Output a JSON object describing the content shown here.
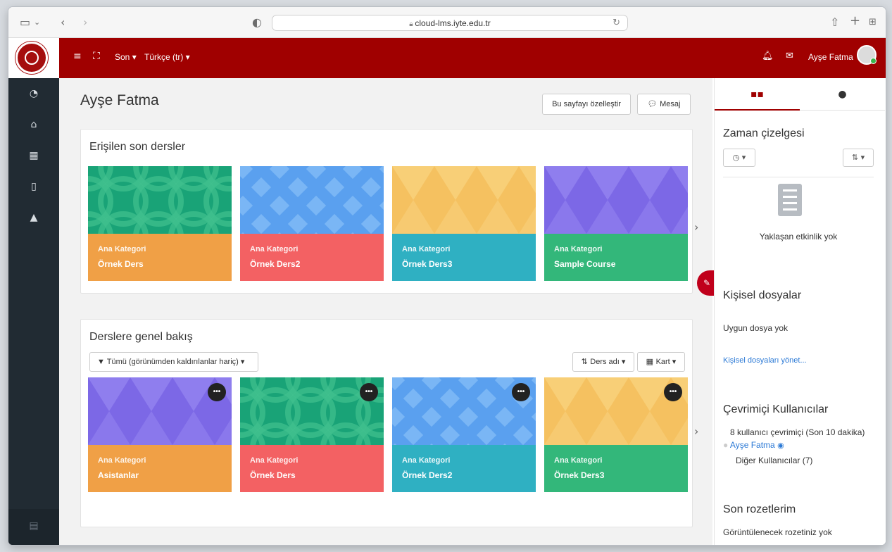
{
  "browser": {
    "url": "cloud-lms.iyte.edu.tr"
  },
  "navbar": {
    "recent_menu": "Son",
    "language_menu": "Türkçe (tr)",
    "user_name": "Ayşe Fatma"
  },
  "page": {
    "title": "Ayşe Fatma",
    "customize_button": "Bu sayfayı özelleştir",
    "message_button": "Mesaj"
  },
  "recent_courses": {
    "title": "Erişilen son dersler",
    "items": [
      {
        "category": "Ana Kategori",
        "name": "Örnek Ders",
        "color": "#f0a046",
        "pattern": "circles-green"
      },
      {
        "category": "Ana Kategori",
        "name": "Örnek Ders2",
        "color": "#f36163",
        "pattern": "diamonds-blue"
      },
      {
        "category": "Ana Kategori",
        "name": "Örnek Ders3",
        "color": "#2fb0c2",
        "pattern": "triangles-yellow"
      },
      {
        "category": "Ana Kategori",
        "name": "Sample Course",
        "color": "#33b77a",
        "pattern": "triangles-purple"
      }
    ]
  },
  "course_overview": {
    "title": "Derslere genel bakış",
    "filter_label": "Tümü (görünümden kaldırılanlar hariç)",
    "sort_label": "Ders adı",
    "view_label": "Kart",
    "items": [
      {
        "category": "Ana Kategori",
        "name": "Asistanlar",
        "color": "#f0a046",
        "pattern": "triangles-purple"
      },
      {
        "category": "Ana Kategori",
        "name": "Örnek Ders",
        "color": "#f36163",
        "pattern": "circles-green"
      },
      {
        "category": "Ana Kategori",
        "name": "Örnek Ders2",
        "color": "#2fb0c2",
        "pattern": "diamonds-blue"
      },
      {
        "category": "Ana Kategori",
        "name": "Örnek Ders3",
        "color": "#33b77a",
        "pattern": "triangles-yellow"
      }
    ]
  },
  "right_drawer": {
    "timeline_title": "Zaman çizelgesi",
    "timeline_empty": "Yaklaşan etkinlik yok",
    "files_title": "Kişisel dosyalar",
    "files_empty": "Uygun dosya yok",
    "files_link": "Kişisel dosyaları yönet...",
    "online_title": "Çevrimiçi Kullanıcılar",
    "online_summary": "8 kullanıcı çevrimiçi (Son 10 dakika)",
    "online_user": "Ayşe Fatma",
    "online_others": "Diğer Kullanıcılar (7)",
    "badges_title": "Son rozetlerim",
    "badges_empty": "Görüntülenecek rozetiniz yok"
  },
  "icons": {
    "sidebar": [
      "dashboard-icon",
      "home-icon",
      "calendar-icon",
      "file-icon",
      "graduation-cap-icon"
    ],
    "header": [
      "menu-icon",
      "fullscreen-icon",
      "bell-icon",
      "envelope-icon"
    ]
  },
  "colors": {
    "brand": "#a00000",
    "drawer": "#212b33",
    "link": "#2c7ad6"
  }
}
